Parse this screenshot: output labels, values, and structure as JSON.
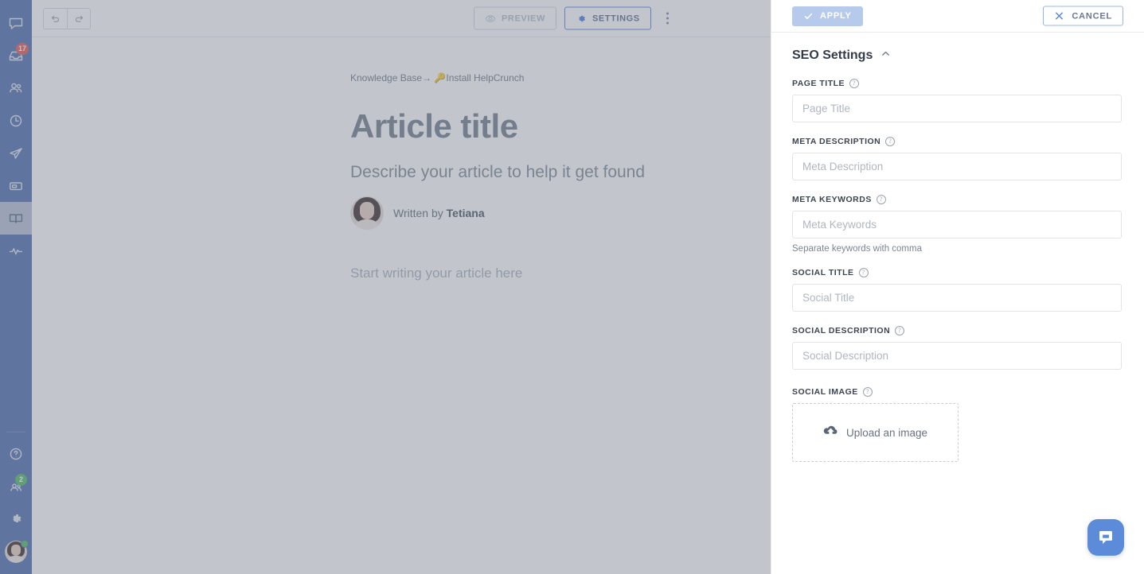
{
  "sidebar": {
    "top_items": [
      {
        "name": "chat",
        "icon": "chat-bubble-icon",
        "badge": null,
        "active": false
      },
      {
        "name": "inbox",
        "icon": "inbox-icon",
        "badge": "17",
        "badge_color": "#e0574f",
        "active": false
      },
      {
        "name": "contacts",
        "icon": "people-icon",
        "badge": null,
        "active": false
      },
      {
        "name": "history",
        "icon": "clock-icon",
        "badge": null,
        "active": false
      },
      {
        "name": "campaigns",
        "icon": "paper-plane-icon",
        "badge": null,
        "active": false
      },
      {
        "name": "popups",
        "icon": "card-icon",
        "badge": null,
        "active": false
      },
      {
        "name": "knowledge-base",
        "icon": "book-icon",
        "badge": null,
        "active": true
      },
      {
        "name": "reports",
        "icon": "pulse-icon",
        "badge": null,
        "active": false
      }
    ],
    "bottom_items": [
      {
        "name": "help",
        "icon": "question-circle-icon",
        "badge": null
      },
      {
        "name": "team",
        "icon": "team-icon",
        "badge": "2",
        "badge_color": "#4cb963"
      },
      {
        "name": "settings",
        "icon": "gear-icon",
        "badge": null
      }
    ],
    "account": {
      "name": "user-avatar",
      "status": "online"
    }
  },
  "toolbar": {
    "undo_label": "Undo",
    "redo_label": "Redo",
    "preview_label": "PREVIEW",
    "settings_label": "SETTINGS",
    "more_label": "More options"
  },
  "editor": {
    "breadcrumb_root": "Knowledge Base",
    "breadcrumb_separator": "→",
    "breadcrumb_emoji": "🔑",
    "breadcrumb_current": "Install HelpCrunch",
    "title": "Article title",
    "subtitle": "Describe your article to help it get found",
    "byline_prefix": "Written by",
    "byline_author": "Tetiana",
    "body_placeholder": "Start writing your article here"
  },
  "panel": {
    "apply_label": "APPLY",
    "cancel_label": "CANCEL",
    "section_title": "SEO Settings",
    "fields": [
      {
        "label": "PAGE TITLE",
        "placeholder": "Page Title",
        "value": "",
        "hint": ""
      },
      {
        "label": "META DESCRIPTION",
        "placeholder": "Meta Description",
        "value": "",
        "hint": ""
      },
      {
        "label": "META KEYWORDS",
        "placeholder": "Meta Keywords",
        "value": "",
        "hint": "Separate keywords with comma"
      },
      {
        "label": "SOCIAL TITLE",
        "placeholder": "Social Title",
        "value": "",
        "hint": ""
      },
      {
        "label": "SOCIAL DESCRIPTION",
        "placeholder": "Social Description",
        "value": "",
        "hint": ""
      }
    ],
    "social_image": {
      "label": "SOCIAL IMAGE",
      "upload_label": "Upload an image"
    },
    "help_glyph": "?"
  },
  "chat_widget": {
    "label": "Open chat"
  },
  "colors": {
    "sidebar_bg": "#4c6bac",
    "accent_blue": "#5b8bd9",
    "apply_disabled": "#b6cbec",
    "badge_red": "#e0574f",
    "badge_green": "#4cb963"
  }
}
